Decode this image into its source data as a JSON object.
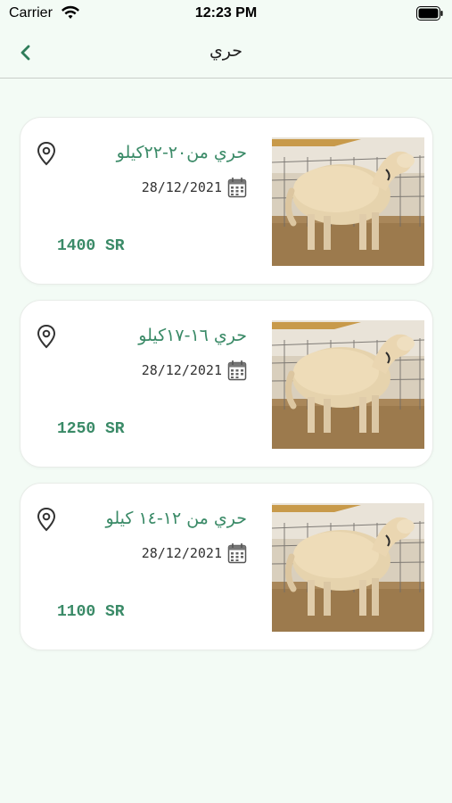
{
  "status_bar": {
    "carrier": "Carrier",
    "time": "12:23 PM",
    "wifi_icon": "wifi-icon",
    "battery_icon": "battery-icon"
  },
  "navbar": {
    "title": "حري",
    "back_icon": "chevron-left-icon"
  },
  "colors": {
    "accent": "#3a8a67",
    "background": "#f3fbf5",
    "card": "#ffffff"
  },
  "listings": [
    {
      "title": "حري من٢٠-٢٢كيلو",
      "date": "28/12/2021",
      "price": "1400 SR"
    },
    {
      "title": "حري ١٦-١٧كيلو",
      "date": "28/12/2021",
      "price": "1250 SR"
    },
    {
      "title": "حري من ١٢-١٤ كيلو",
      "date": "28/12/2021",
      "price": "1100 SR"
    }
  ]
}
